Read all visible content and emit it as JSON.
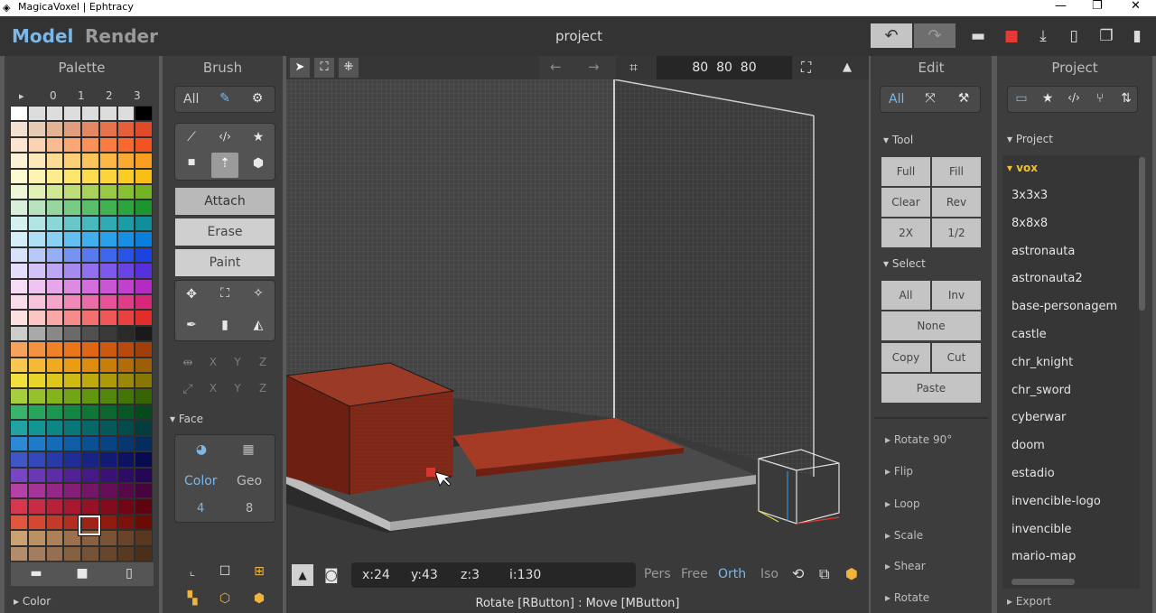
{
  "window": {
    "title": "MagicaVoxel | Ephtracy",
    "min": "—",
    "max": "❐",
    "close": "✕"
  },
  "topbar": {
    "mode_model": "Model",
    "mode_render": "Render",
    "project_title": "project",
    "undo": "↶",
    "redo": "↷"
  },
  "palette": {
    "title": "Palette",
    "tabs": [
      "▸",
      "0",
      "1",
      "2",
      "3"
    ],
    "footer_section": "▸ Color",
    "colors": [
      "#ffffff",
      "#dddddd",
      "#dddddd",
      "#dddddd",
      "#dddddd",
      "#dddddd",
      "#dddddd",
      "#000000",
      "#f2e0d0",
      "#e8cbb3",
      "#e2b495",
      "#e29d7d",
      "#e48763",
      "#e5734c",
      "#e55f3a",
      "#e04a28",
      "#fbe4d0",
      "#fbd2b2",
      "#fbbb92",
      "#fca673",
      "#fb9158",
      "#fb7b41",
      "#fa6830",
      "#f55222",
      "#fdf2d5",
      "#fce8b8",
      "#fcdc95",
      "#fdd075",
      "#fdc459",
      "#fcb744",
      "#fba930",
      "#fa9e20",
      "#fefad2",
      "#fdf3b2",
      "#fdec8e",
      "#fde56c",
      "#fddd4f",
      "#fcd53a",
      "#fbcc26",
      "#f8c016",
      "#eff8d6",
      "#e1f0b5",
      "#d0e795",
      "#bddd76",
      "#a9d35a",
      "#98ca45",
      "#87c031",
      "#74b323",
      "#d8f0da",
      "#b8e4bd",
      "#97d79f",
      "#77cb82",
      "#58be67",
      "#41b252",
      "#2ca53f",
      "#1d952f",
      "#d5f1ef",
      "#b2e4e3",
      "#8dd6d7",
      "#69c7cb",
      "#47b9bf",
      "#2fabb3",
      "#1b9da6",
      "#0f8d98",
      "#d4eefa",
      "#b0e0f6",
      "#89d0f2",
      "#63bff0",
      "#41aeed",
      "#2a9fea",
      "#168fe5",
      "#0a7edb",
      "#d8e2fb",
      "#b8c9f8",
      "#96aef5",
      "#7593f2",
      "#577aef",
      "#3f66ec",
      "#2953e7",
      "#1c43de",
      "#e6dcfb",
      "#d2c2f8",
      "#bca6f5",
      "#a68af2",
      "#9070ef",
      "#7c58ec",
      "#6a43e7",
      "#5730de",
      "#f6dcf7",
      "#efc3f1",
      "#e6a6ea",
      "#dd8ae3",
      "#d46edc",
      "#cb56d5",
      "#c140cd",
      "#b22cc3",
      "#fbdcea",
      "#f8c2da",
      "#f4a5c9",
      "#f088b8",
      "#ec6ca7",
      "#e85298",
      "#e23b88",
      "#d82678",
      "#fde0e0",
      "#fbc5c4",
      "#f8a8a7",
      "#f58b8a",
      "#f2706f",
      "#ef5856",
      "#ea4140",
      "#e22d2c",
      "#cccccc",
      "#a9a9a9",
      "#888888",
      "#6a6a6a",
      "#505050",
      "#3a3a3a",
      "#2a2a2a",
      "#1a1a1a",
      "#f5a25a",
      "#f4933f",
      "#ef8226",
      "#e9741a",
      "#de6614",
      "#cc590f",
      "#b84b0b",
      "#a03f08",
      "#f9c64e",
      "#f6b935",
      "#f1aa1e",
      "#ea9c12",
      "#dd8c0e",
      "#c97d0b",
      "#b36d08",
      "#9c5e06",
      "#f2e03e",
      "#e9d42a",
      "#ddc71c",
      "#cfb913",
      "#beaa0e",
      "#ad9a0b",
      "#9a8908",
      "#877806",
      "#a6cf3d",
      "#95c22b",
      "#83b41e",
      "#72a515",
      "#629610",
      "#53860c",
      "#457509",
      "#376506",
      "#39b46a",
      "#27a55c",
      "#1b964f",
      "#138643",
      "#0e7738",
      "#0b672e",
      "#085825",
      "#06491c",
      "#1fa3a3",
      "#139595",
      "#0d8686",
      "#097777",
      "#076868",
      "#055959",
      "#044b4b",
      "#033d3d",
      "#2d89d6",
      "#1f7ac7",
      "#156bb7",
      "#0f5da6",
      "#0b5095",
      "#084383",
      "#063771",
      "#042c5f",
      "#3f56c9",
      "#3247b9",
      "#283aa8",
      "#1f2e97",
      "#182485",
      "#121a73",
      "#0d1262",
      "#090b52",
      "#7846c4",
      "#6a38b5",
      "#5d2ca6",
      "#512296",
      "#451986",
      "#3a1175",
      "#300b65",
      "#260656",
      "#b541a6",
      "#a53496",
      "#952887",
      "#851e78",
      "#751568",
      "#660e5a",
      "#57084b",
      "#48043e",
      "#d7364f",
      "#c82b44",
      "#b8213a",
      "#a71830",
      "#951126",
      "#830b1e",
      "#710616",
      "#600310",
      "#e2553f",
      "#d44733",
      "#c43a28",
      "#b32e1e",
      "#a12316",
      "#8f1a0f",
      "#7c1209",
      "#6a0b05",
      "#c9a173",
      "#bb9065",
      "#ac8058",
      "#9c704b",
      "#8b603f",
      "#7a5234",
      "#6a4429",
      "#5a371f",
      "#b28c6b",
      "#a37d5e",
      "#946f51",
      "#856144",
      "#765338",
      "#67462d",
      "#583a23",
      "#4a2f1a"
    ]
  },
  "brush": {
    "title": "Brush",
    "tab_all": "All",
    "modes": [
      "Attach",
      "Erase",
      "Paint"
    ],
    "axis_labels": [
      "X",
      "Y",
      "Z"
    ],
    "face_section": "▾ Face",
    "face_color_label": "Color",
    "face_geo_label": "Geo",
    "face_color_value": "4",
    "face_geo_value": "8"
  },
  "viewport": {
    "size_field": "80  80  80",
    "coords": {
      "x": "x:24",
      "y": "y:43",
      "z": "z:3",
      "i": "i:130"
    },
    "cameras": [
      "Pers",
      "Free",
      "Orth",
      "Iso"
    ],
    "active_camera": "Orth",
    "hint": "Rotate [RButton] : Move [MButton]"
  },
  "edit": {
    "title": "Edit",
    "tab_all": "All",
    "tool_section": "▾ Tool",
    "tool_buttons": [
      "Full",
      "Fill",
      "Clear",
      "Rev",
      "2X",
      "1/2"
    ],
    "select_section": "▾ Select",
    "select_buttons": [
      "All",
      "Inv",
      "None",
      "Copy",
      "Cut",
      "Paste"
    ],
    "collapsed_sections": [
      "▸ Rotate 90°",
      "▸ Flip",
      "▸ Loop",
      "▸ Scale",
      "▸ Shear",
      "▸ Rotate"
    ]
  },
  "project": {
    "title": "Project",
    "section": "▾ Project",
    "folder": "▾ vox",
    "items": [
      "3x3x3",
      "8x8x8",
      "astronauta",
      "astronauta2",
      "base-personagem",
      "castle",
      "chr_knight",
      "chr_sword",
      "cyberwar",
      "doom",
      "estadio",
      "invencible-logo",
      "invencible",
      "mario-map"
    ],
    "footer_section": "▸ Export"
  },
  "colors": {
    "accent": "#7cb7e8",
    "selected_voxel": "#8e2f1f",
    "save_red": "#e53935"
  }
}
